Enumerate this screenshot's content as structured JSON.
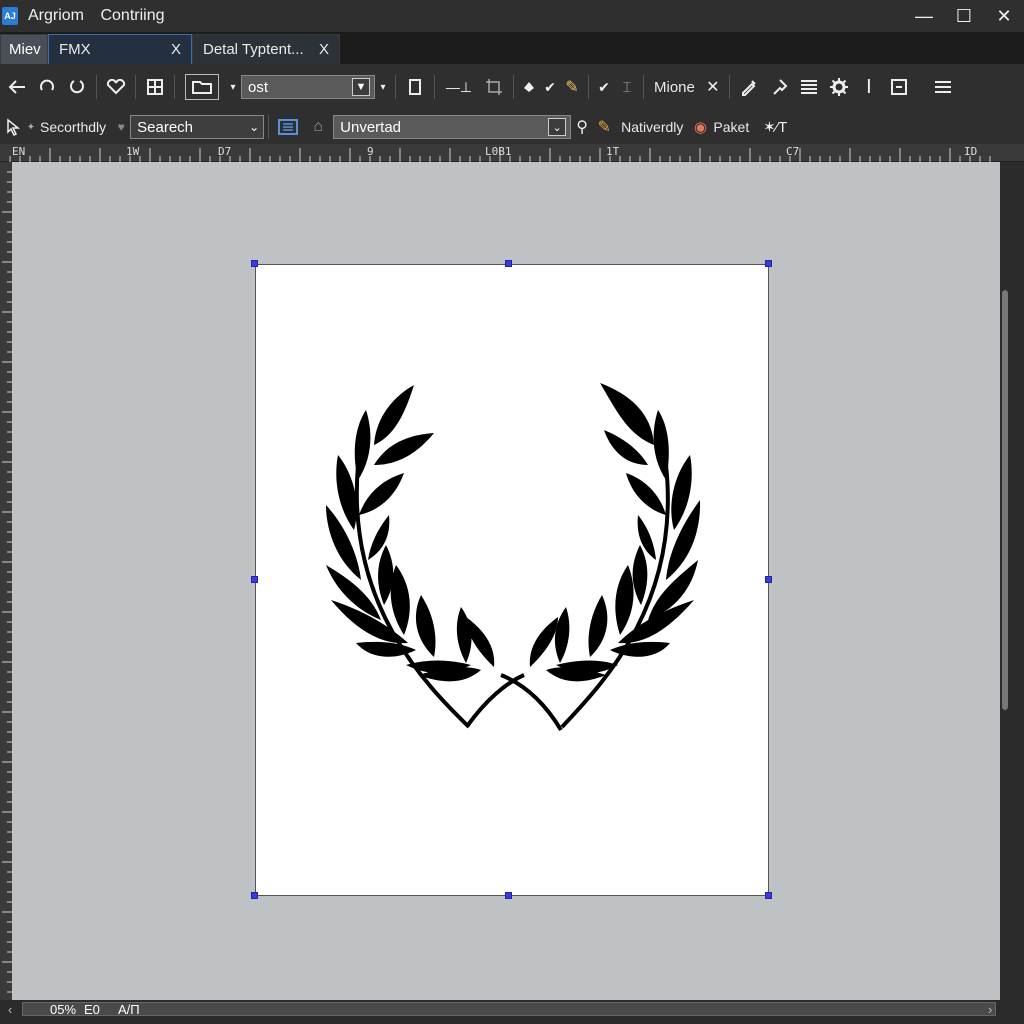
{
  "window": {
    "app_icon_text": "AJ",
    "title_part1": "Argriom",
    "title_part2": "Contriing",
    "minimize": "—",
    "maximize": "☐",
    "close": "✕"
  },
  "tabs": [
    {
      "label": "Miev",
      "close": ""
    },
    {
      "label": "FMX",
      "close": "X"
    },
    {
      "label": "Detal Typtent...",
      "close": "X"
    }
  ],
  "toolbar1": {
    "font_select_value": "ost",
    "mione_label": "Mione"
  },
  "toolbar2": {
    "secondary_label": "Secorthdly",
    "search_value": "Searech",
    "style_select_value": "Unvertad",
    "natively_label": "Nativerdly",
    "paket_label": "Paket"
  },
  "ruler": {
    "labels": [
      "EN",
      "1W",
      "D7",
      "9",
      "L0B1",
      "1T",
      "C7",
      "ID"
    ]
  },
  "status": {
    "zoom": "05%",
    "coords": "E0",
    "mode": "A/П"
  },
  "artwork": {
    "subject": "laurel-wreath",
    "fill_color": "#000000"
  }
}
